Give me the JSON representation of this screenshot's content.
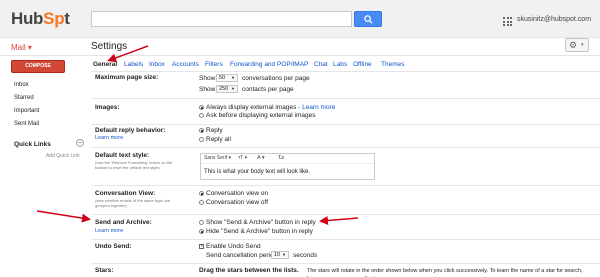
{
  "header": {
    "logo_main": "Hub",
    "logo_accent": "Sp",
    "logo_tail": "t",
    "search_placeholder": "",
    "user_email": "skusinitz@hubspot.com"
  },
  "subheader": {
    "mail_label": "Mail ▾",
    "title": "Settings",
    "gear_caret": "▾"
  },
  "sidebar": {
    "compose": "COMPOSE",
    "items": [
      "Inbox",
      "Starred",
      "Important",
      "Sent Mail"
    ],
    "quick_links": "Quick Links",
    "quick_links_toggle": "–",
    "add_quick_link": "Add Quick Link"
  },
  "tabs": [
    "General",
    "Labels",
    "Inbox",
    "Accounts",
    "Filters",
    "Forwarding and POP/IMAP",
    "Chat",
    "Labs",
    "Offline",
    "Themes"
  ],
  "rows": {
    "max_page_size": {
      "label": "Maximum page size:",
      "show1": "Show",
      "conv_value": "50",
      "conv_text": "conversations per page",
      "show2": "Show",
      "contact_value": "250",
      "contact_text": "contacts per page"
    },
    "images": {
      "label": "Images:",
      "opt1": "Always display external images",
      "opt1_link": "- Learn more",
      "opt2": "Ask before displaying external images"
    },
    "reply": {
      "label": "Default reply behavior:",
      "learn_more": "Learn more",
      "opt1": "Reply",
      "opt2": "Reply all"
    },
    "text_style": {
      "label": "Default text style:",
      "sub": "(Use the 'Remove Formatting' button on the toolbar to reset the default text style)",
      "font": "Sans Serif  ▾",
      "size_icon": "тT ▾",
      "color_icon": "A ▾",
      "clear_icon": "T̶x",
      "body": "This is what your body text will look like."
    },
    "conversation_view": {
      "label": "Conversation View:",
      "sub": "(sets whether emails of the same topic are grouped together)",
      "opt1": "Conversation view on",
      "opt2": "Conversation view off"
    },
    "send_archive": {
      "label": "Send and Archive:",
      "learn_more": "Learn more",
      "opt1": "Show \"Send & Archive\" button in reply",
      "opt2": "Hide \"Send & Archive\" button in reply"
    },
    "undo_send": {
      "label": "Undo Send:",
      "opt1": "Enable Undo Send",
      "cancel_text": "Send cancellation period:",
      "seconds_value": "10",
      "seconds_text": "seconds"
    },
    "stars": {
      "label": "Stars:",
      "text": "Drag the stars between the lists.",
      "text2": "The stars will rotate in the order shown below when you click successively. To learn the name of a star for search, hover your mouse over the image."
    }
  },
  "colors": {
    "accent_red": "#dd4b39",
    "link_blue": "#1155cc",
    "search_blue": "#4a8af4",
    "arrow_red": "#d0021b"
  }
}
